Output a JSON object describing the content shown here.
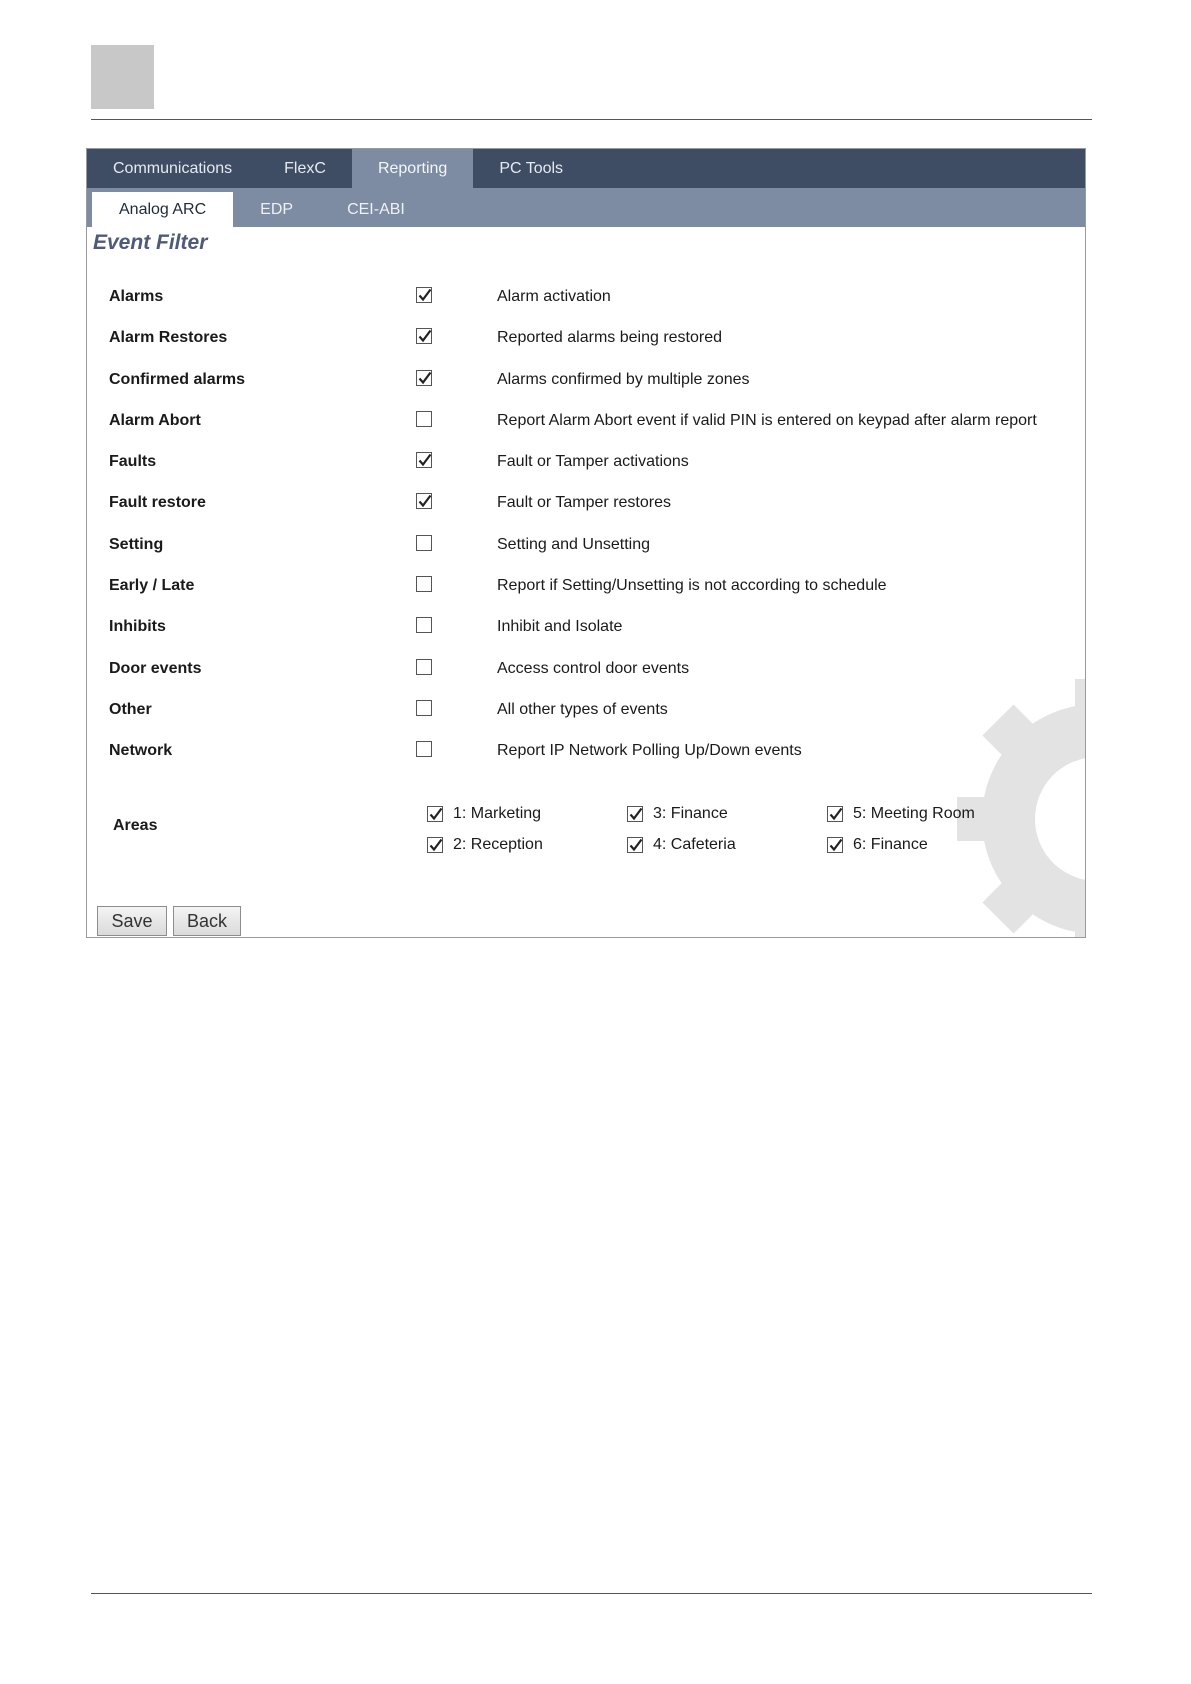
{
  "nav": {
    "main_tabs": [
      {
        "label": "Communications",
        "active": false
      },
      {
        "label": "FlexC",
        "active": false
      },
      {
        "label": "Reporting",
        "active": true
      },
      {
        "label": "PC Tools",
        "active": false
      }
    ],
    "sub_tabs": [
      {
        "label": "Analog ARC",
        "active": true
      },
      {
        "label": "EDP",
        "active": false
      },
      {
        "label": "CEI-ABI",
        "active": false
      }
    ]
  },
  "section_title": "Event Filter",
  "rows": [
    {
      "label": "Alarms",
      "checked": true,
      "description": "Alarm activation"
    },
    {
      "label": "Alarm Restores",
      "checked": true,
      "description": "Reported alarms being restored"
    },
    {
      "label": "Confirmed alarms",
      "checked": true,
      "description": "Alarms confirmed by multiple zones"
    },
    {
      "label": "Alarm Abort",
      "checked": false,
      "description": "Report Alarm Abort event if valid PIN is entered on keypad after alarm report"
    },
    {
      "label": "Faults",
      "checked": true,
      "description": "Fault or Tamper activations"
    },
    {
      "label": "Fault restore",
      "checked": true,
      "description": "Fault or Tamper restores"
    },
    {
      "label": "Setting",
      "checked": false,
      "description": "Setting and Unsetting"
    },
    {
      "label": "Early / Late",
      "checked": false,
      "description": "Report if Setting/Unsetting is not according to schedule"
    },
    {
      "label": "Inhibits",
      "checked": false,
      "description": "Inhibit and Isolate"
    },
    {
      "label": "Door events",
      "checked": false,
      "description": "Access control door events"
    },
    {
      "label": "Other",
      "checked": false,
      "description": "All other types of events"
    },
    {
      "label": "Network",
      "checked": false,
      "description": "Report IP Network Polling Up/Down events"
    }
  ],
  "areas": {
    "label": "Areas",
    "items": [
      {
        "label": "1: Marketing",
        "checked": true
      },
      {
        "label": "2: Reception",
        "checked": true
      },
      {
        "label": "3: Finance",
        "checked": true
      },
      {
        "label": "4: Cafeteria",
        "checked": true
      },
      {
        "label": "5: Meeting Room",
        "checked": true
      },
      {
        "label": "6: Finance",
        "checked": true
      }
    ]
  },
  "buttons": {
    "save": "Save",
    "back": "Back"
  },
  "colors": {
    "nav_dark": "#3e4c64",
    "nav_light": "#7d8ba3",
    "title": "#4d5a7a"
  }
}
